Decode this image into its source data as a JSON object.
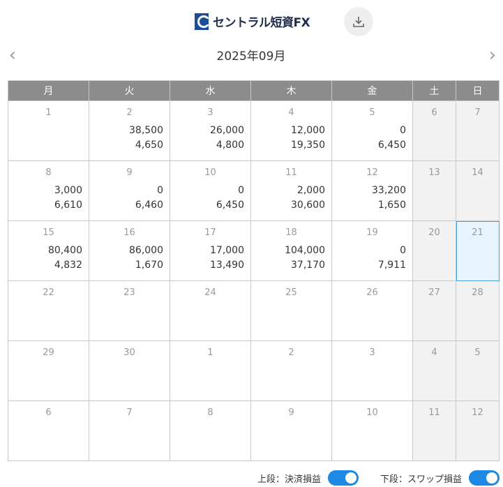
{
  "header": {
    "logo_text": "セントラル短資FX"
  },
  "nav": {
    "prev": "‹",
    "next": "›",
    "month_title": "2025年09月"
  },
  "weekdays": [
    "月",
    "火",
    "水",
    "木",
    "金",
    "土",
    "日"
  ],
  "weeks": [
    [
      {
        "day": "1",
        "top": "",
        "bottom": ""
      },
      {
        "day": "2",
        "top": "38,500",
        "bottom": "4,650"
      },
      {
        "day": "3",
        "top": "26,000",
        "bottom": "4,800"
      },
      {
        "day": "4",
        "top": "12,000",
        "bottom": "19,350"
      },
      {
        "day": "5",
        "top": "0",
        "bottom": "6,450"
      },
      {
        "day": "6",
        "top": "",
        "bottom": ""
      },
      {
        "day": "7",
        "top": "",
        "bottom": ""
      }
    ],
    [
      {
        "day": "8",
        "top": "3,000",
        "bottom": "6,610"
      },
      {
        "day": "9",
        "top": "0",
        "bottom": "6,460"
      },
      {
        "day": "10",
        "top": "0",
        "bottom": "6,450"
      },
      {
        "day": "11",
        "top": "2,000",
        "bottom": "30,600"
      },
      {
        "day": "12",
        "top": "33,200",
        "bottom": "1,650"
      },
      {
        "day": "13",
        "top": "",
        "bottom": ""
      },
      {
        "day": "14",
        "top": "",
        "bottom": ""
      }
    ],
    [
      {
        "day": "15",
        "top": "80,400",
        "bottom": "4,832"
      },
      {
        "day": "16",
        "top": "86,000",
        "bottom": "1,670"
      },
      {
        "day": "17",
        "top": "17,000",
        "bottom": "13,490"
      },
      {
        "day": "18",
        "top": "104,000",
        "bottom": "37,170"
      },
      {
        "day": "19",
        "top": "0",
        "bottom": "7,911"
      },
      {
        "day": "20",
        "top": "",
        "bottom": ""
      },
      {
        "day": "21",
        "top": "",
        "bottom": "",
        "today": true
      }
    ],
    [
      {
        "day": "22",
        "top": "",
        "bottom": ""
      },
      {
        "day": "23",
        "top": "",
        "bottom": ""
      },
      {
        "day": "24",
        "top": "",
        "bottom": ""
      },
      {
        "day": "25",
        "top": "",
        "bottom": ""
      },
      {
        "day": "26",
        "top": "",
        "bottom": ""
      },
      {
        "day": "27",
        "top": "",
        "bottom": ""
      },
      {
        "day": "28",
        "top": "",
        "bottom": ""
      }
    ],
    [
      {
        "day": "29",
        "top": "",
        "bottom": ""
      },
      {
        "day": "30",
        "top": "",
        "bottom": ""
      },
      {
        "day": "1",
        "top": "",
        "bottom": ""
      },
      {
        "day": "2",
        "top": "",
        "bottom": ""
      },
      {
        "day": "3",
        "top": "",
        "bottom": ""
      },
      {
        "day": "4",
        "top": "",
        "bottom": ""
      },
      {
        "day": "5",
        "top": "",
        "bottom": ""
      }
    ],
    [
      {
        "day": "6",
        "top": "",
        "bottom": ""
      },
      {
        "day": "7",
        "top": "",
        "bottom": ""
      },
      {
        "day": "8",
        "top": "",
        "bottom": ""
      },
      {
        "day": "9",
        "top": "",
        "bottom": ""
      },
      {
        "day": "10",
        "top": "",
        "bottom": ""
      },
      {
        "day": "11",
        "top": "",
        "bottom": ""
      },
      {
        "day": "12",
        "top": "",
        "bottom": ""
      }
    ]
  ],
  "footer": {
    "toggle_top_label": "上段：決済損益",
    "toggle_top_on": true,
    "toggle_bottom_label": "下段：スワップ損益",
    "toggle_bottom_on": true
  },
  "colors": {
    "header_bg": "#8c8c8c",
    "weekend_bg": "#f2f2f2",
    "today_bg": "#e8f4fd",
    "today_border": "#4a9fd8",
    "toggle_on": "#1e88e5"
  }
}
